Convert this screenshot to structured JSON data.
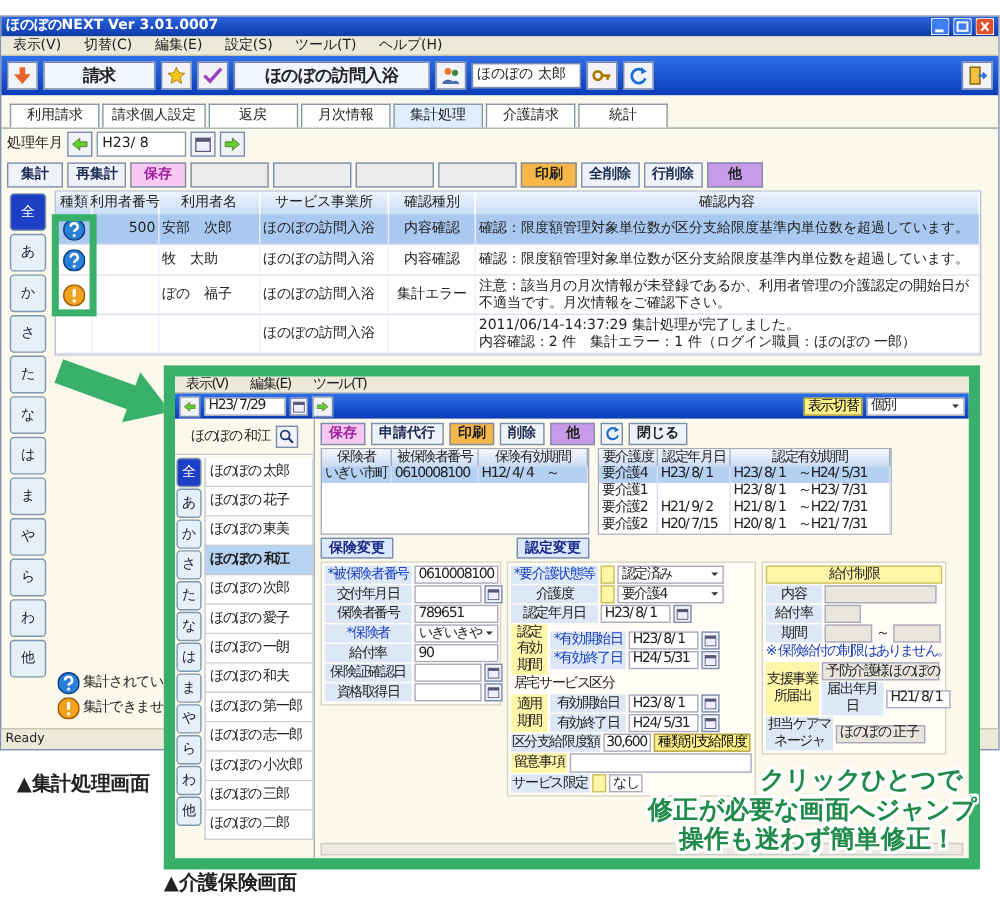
{
  "window": {
    "title": "ほのぼのNEXT Ver 3.01.0007"
  },
  "menu": [
    "表示(V)",
    "切替(C)",
    "編集(E)",
    "設定(S)",
    "ツール(T)",
    "ヘルプ(H)"
  ],
  "header": {
    "module": "請求",
    "office": "ほのぼの訪問入浴",
    "user": "ほのぼの 太郎"
  },
  "tabs": [
    {
      "label": "利用請求",
      "selected": false
    },
    {
      "label": "請求個人設定",
      "selected": false
    },
    {
      "label": "返戻",
      "selected": false
    },
    {
      "label": "月次情報",
      "selected": false
    },
    {
      "label": "集計処理",
      "selected": true
    },
    {
      "label": "介護請求",
      "selected": false
    },
    {
      "label": "統計",
      "selected": false
    }
  ],
  "period": {
    "label": "処理年月",
    "value": "H23/ 8"
  },
  "toolbar": [
    {
      "kind": "plain",
      "label": "集計"
    },
    {
      "kind": "plain",
      "label": "再集計"
    },
    {
      "kind": "save",
      "label": "保存"
    },
    {
      "kind": "blank"
    },
    {
      "kind": "blank"
    },
    {
      "kind": "blank"
    },
    {
      "kind": "blank"
    },
    {
      "kind": "print",
      "label": "印刷"
    },
    {
      "kind": "plain",
      "label": "全削除"
    },
    {
      "kind": "plain",
      "label": "行削除"
    },
    {
      "kind": "other",
      "label": "他"
    }
  ],
  "index_tabs": [
    {
      "label": "全",
      "selected": true
    },
    {
      "label": "あ",
      "selected": false
    },
    {
      "label": "か",
      "selected": false
    },
    {
      "label": "さ",
      "selected": false
    },
    {
      "label": "た",
      "selected": false
    },
    {
      "label": "な",
      "selected": false
    },
    {
      "label": "は",
      "selected": false
    },
    {
      "label": "ま",
      "selected": false
    },
    {
      "label": "や",
      "selected": false
    },
    {
      "label": "ら",
      "selected": false
    },
    {
      "label": "わ",
      "selected": false
    },
    {
      "label": "他",
      "selected": false
    }
  ],
  "table": {
    "columns": [
      "種類",
      "利用者番号",
      "利用者名",
      "サービス事業所",
      "確認種別",
      "確認内容"
    ],
    "rows": [
      {
        "kind": "info",
        "selected": true,
        "user_no": "500",
        "user_name": "安部　次郎",
        "office": "ほのぼの訪問入浴",
        "check_type": "内容確認",
        "content": [
          "確認：限度額管理対象単位数が区分支給限度基準内単位数を超過しています。"
        ]
      },
      {
        "kind": "info",
        "selected": false,
        "user_name": "牧　太助",
        "office": "ほのぼの訪問入浴",
        "check_type": "内容確認",
        "content": [
          "確認：限度額管理対象単位数が区分支給限度基準内単位数を超過しています。"
        ]
      },
      {
        "kind": "error",
        "selected": false,
        "user_name": "ぼの　福子",
        "office": "ほのぼの訪問入浴",
        "check_type": "集計エラー",
        "content": [
          "注意：該当月の月次情報が未登録であるか、利用者管理の介護認定の開始日が不適当です。月次情報をご確認下さい。"
        ]
      },
      {
        "kind": "none",
        "selected": false,
        "office": "ほのぼの訪問入浴",
        "content": [
          "2011/06/14-14:37:29 集計処理が完了しました。",
          "内容確認：2 件　集計エラー：1 件（ログイン職員：ほのぼの 一郎）"
        ]
      }
    ]
  },
  "legend": [
    {
      "kind": "info",
      "label": "集計されてい"
    },
    {
      "kind": "error",
      "label": "集計できませ"
    }
  ],
  "status_bar": "Ready",
  "caption": "▲集計処理画面",
  "inset": {
    "caption": "▲介護保険画面",
    "menu": [
      "表示(V)",
      "編集(E)",
      "ツール(T)"
    ],
    "date": "H23/ 7/29",
    "view_button": "表示切替",
    "view_select": "個別",
    "current_user": "ほのぼの 和江",
    "index_tabs": [
      {
        "label": "全",
        "selected": true
      },
      {
        "label": "あ",
        "selected": false
      },
      {
        "label": "か",
        "selected": false
      },
      {
        "label": "さ",
        "selected": false
      },
      {
        "label": "た",
        "selected": false
      },
      {
        "label": "な",
        "selected": false
      },
      {
        "label": "は",
        "selected": false
      },
      {
        "label": "ま",
        "selected": false
      },
      {
        "label": "や",
        "selected": false
      },
      {
        "label": "ら",
        "selected": false
      },
      {
        "label": "わ",
        "selected": false
      },
      {
        "label": "他",
        "selected": false
      }
    ],
    "users": [
      {
        "name": "ほのぼの 太郎",
        "selected": false
      },
      {
        "name": "ほのぼの 花子",
        "selected": false
      },
      {
        "name": "ほのぼの 東美",
        "selected": false
      },
      {
        "name": "ほのぼの 和江",
        "selected": true
      },
      {
        "name": "ほのぼの 次郎",
        "selected": false
      },
      {
        "name": "ほのぼの 愛子",
        "selected": false
      },
      {
        "name": "ほのぼの 一朗",
        "selected": false
      },
      {
        "name": "ほのぼの 和夫",
        "selected": false
      },
      {
        "name": "ほのぼの 第一郎",
        "selected": false
      },
      {
        "name": "ほのぼの 志一郎",
        "selected": false
      },
      {
        "name": "ほのぼの 小次郎",
        "selected": false
      },
      {
        "name": "ほのぼの 三郎",
        "selected": false
      },
      {
        "name": "ほのぼの 二郎",
        "selected": false
      }
    ],
    "toolbar": [
      {
        "kind": "save",
        "label": "保存"
      },
      {
        "kind": "plain",
        "label": "申請代行"
      },
      {
        "kind": "print",
        "label": "印刷"
      },
      {
        "kind": "plain",
        "label": "削除"
      },
      {
        "kind": "other",
        "label": "他"
      },
      {
        "kind": "refresh"
      },
      {
        "kind": "close",
        "label": "閉じる"
      }
    ],
    "insurance_table": {
      "columns": [
        "保険者",
        "被保険者番号",
        "保険有効期間"
      ],
      "rows": [
        {
          "selected": true,
          "cells": [
            "いぎい市町",
            "0610008100",
            "H12/ 4/ 4　～"
          ]
        }
      ]
    },
    "care_table": {
      "columns": [
        "要介護度",
        "認定年月日",
        "認定有効期間"
      ],
      "rows": [
        {
          "selected": true,
          "cells": [
            "要介護4",
            "H23/ 8/ 1",
            "H23/ 8/ 1　～H24/ 5/31"
          ]
        },
        {
          "selected": false,
          "cells": [
            "要介護1",
            "",
            "H23/ 8/ 1　～H23/ 7/31"
          ]
        },
        {
          "selected": false,
          "cells": [
            "要介護2",
            "H21/ 9/ 2",
            "H21/ 8/ 1　～H22/ 7/31"
          ]
        },
        {
          "selected": false,
          "cells": [
            "要介護2",
            "H20/ 7/15",
            "H20/ 8/ 1　～H21/ 7/31"
          ]
        }
      ]
    },
    "insurance_button": "保険変更",
    "cert_button": "認定変更",
    "insurance_form": [
      {
        "kind": "text",
        "label": "*被保険者番号",
        "required": true,
        "value": "0610008100"
      },
      {
        "kind": "date",
        "label": "交付年月日",
        "required": false
      },
      {
        "kind": "text",
        "label": "保険者番号",
        "required": false,
        "value": "789651"
      },
      {
        "kind": "select",
        "label": "*保険者",
        "required": true,
        "value": "いぎいきや"
      },
      {
        "kind": "text",
        "label": "給付率",
        "required": false,
        "value": "90"
      },
      {
        "kind": "date",
        "label": "保険証確認日",
        "required": false
      },
      {
        "kind": "date",
        "label": "資格取得日",
        "required": false
      }
    ],
    "cert_form": {
      "status_label": "*要介護状態等",
      "status": "認定済み",
      "level_label": "介護度",
      "level": "要介護4",
      "date_label": "認定年月日",
      "date": "H23/ 8/ 1",
      "period_label": "認定有効期間",
      "period": [
        {
          "label": "*有効開始日",
          "value": "H23/ 8/ 1"
        },
        {
          "label": "*有効終了日",
          "value": "H24/ 5/31"
        }
      ],
      "service_heading": "居宅サービス区分",
      "apply_label": "適用期間",
      "apply": [
        {
          "label": "有効開始日",
          "value": "H23/ 8/ 1"
        },
        {
          "label": "有効終了日",
          "value": "H24/ 5/31"
        }
      ],
      "limit_label": "区分支給限度額",
      "limit": "30,600",
      "limit_button": "種類別支給限度",
      "notes_label": "留意事項",
      "service_limit_label": "サービス限定",
      "service_limit": "なし"
    },
    "benefit": {
      "heading": "給付制限",
      "content_label": "内容",
      "rate_label": "給付率",
      "period_label": "期間",
      "period_sep": "～",
      "note": "※ 保険給付の制限はありません。",
      "support_label": "支援事業所届出",
      "support_office": "予防介護様ほのぼの",
      "filed_label": "届出年月日",
      "filed": "H21/ 8/ 1",
      "manager_label": "担当ケアマネージャ",
      "manager": "ほのぼの 正子"
    }
  },
  "promo": [
    "クリックひとつで",
    "修正が必要な画面へジャンプ",
    "操作も迷わず簡単修正！"
  ]
}
